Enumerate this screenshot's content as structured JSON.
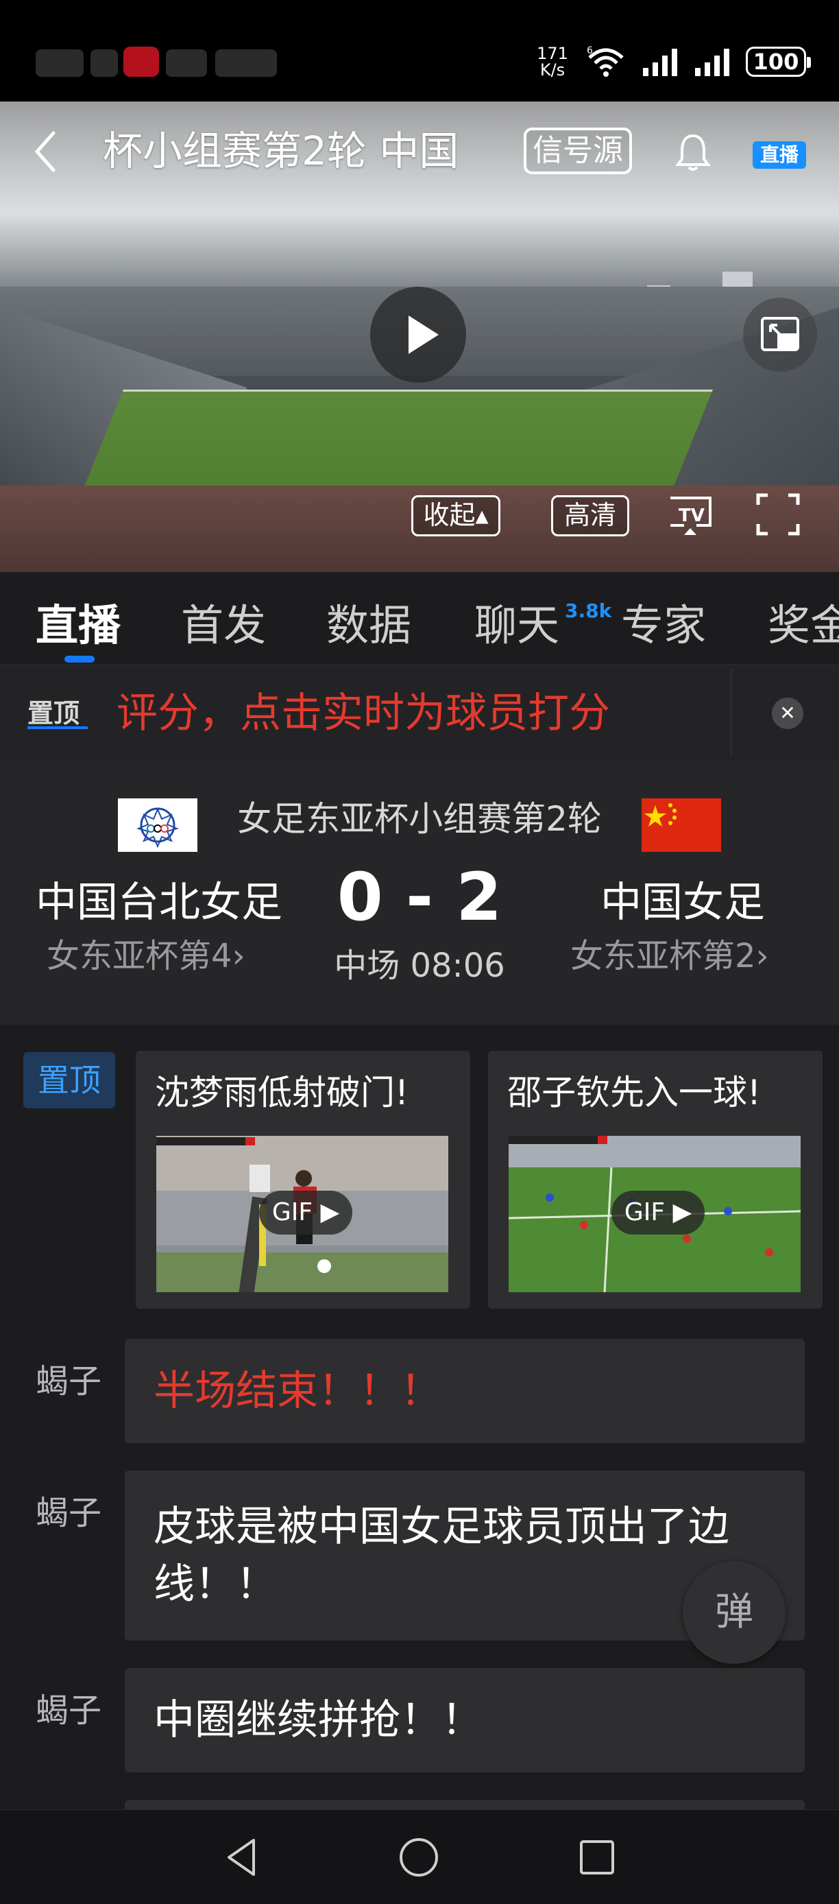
{
  "status_bar": {
    "net_speed_value": "171",
    "net_speed_unit": "K/s",
    "wifi_badge": "6",
    "battery": "100"
  },
  "video": {
    "title": "杯小组赛第2轮 中国",
    "signal_source_label": "信号源",
    "live_badge": "直播",
    "collapse_label": "收起▴",
    "quality_label": "高清"
  },
  "tabs": [
    {
      "label": "直播",
      "active": true
    },
    {
      "label": "首发"
    },
    {
      "label": "数据"
    },
    {
      "label": "聊天",
      "badge": "3.8k"
    },
    {
      "label": "专家"
    },
    {
      "label": "奖金"
    }
  ],
  "ticker": {
    "pin_label": "置顶",
    "text": "评分，点击实时为球员打分"
  },
  "match": {
    "title": "女足东亚杯小组赛第2轮",
    "home_team": "中国台北女足",
    "home_rank": "女东亚杯第4›",
    "away_team": "中国女足",
    "away_rank": "女东亚杯第2›",
    "score": "0 - 2",
    "status": "中场 08:06"
  },
  "feed": {
    "pin_label": "置顶",
    "highlights": [
      {
        "title": "沈梦雨低射破门!",
        "badge": "GIF"
      },
      {
        "title": "邵子钦先入一球!",
        "badge": "GIF"
      }
    ],
    "messages": [
      {
        "user": "蝎子",
        "text": "半场结束！！！",
        "highlight": true
      },
      {
        "user": "蝎子",
        "text": "皮球是被中国女足球员顶出了边线！！"
      },
      {
        "user": "蝎子",
        "text": "中圈继续拼抢！！"
      }
    ],
    "danmu_button": "弹"
  },
  "colors": {
    "accent": "#1677ff",
    "alert_red": "#e63a2e",
    "background": "#1c1c1e"
  }
}
